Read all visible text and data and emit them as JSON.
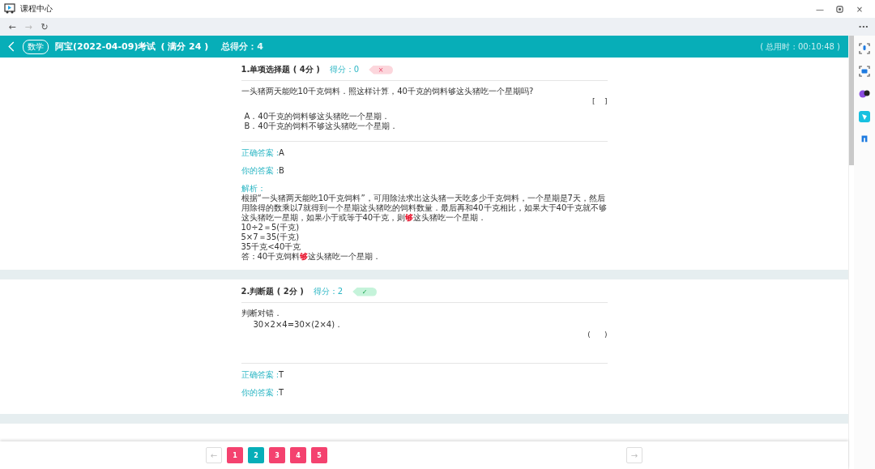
{
  "window": {
    "title": "课程中心"
  },
  "header": {
    "subject": "数学",
    "title": "阿宝(2022-04-09)考试",
    "full_score": "( 满分 24 )",
    "total": "总得分：4",
    "time": "( 总用时 : 00:10:48 )"
  },
  "questions": [
    {
      "heading": "1.单项选择题 ( 4分 )",
      "score": "得分：0",
      "passed": false,
      "mark": "×",
      "stem": [
        "一头猪两天能吃10千克饲料．照这样计算，40千克的饲料够这头猪吃一个星期吗?"
      ],
      "blank": "[    ]",
      "options": [
        "A．40千克的饲料够这头猪吃一个星期．",
        "B．40千克的饲料不够这头猪吃一个星期．"
      ],
      "correct_label": "正确答案 :",
      "correct": "A",
      "yours_label": "你的答案 :",
      "yours": "B",
      "analysis_label": "解析：",
      "analysis": [
        [
          {
            "text": "根据“一头猪两天能吃10千克饲料”，可用除法求出这头猪一天吃多少千克饲料，一个星期是7天，然后用除得的数乘以7就得到一个星期这头猪吃的饲料数量．最后再和40千克相比，如果大于40千克就不够这头猪吃一星期，如果小于或等于40千克，则",
            "highlight": false
          },
          {
            "text": "够",
            "highlight": true
          },
          {
            "text": "这头猪吃一个星期．",
            "highlight": false
          }
        ],
        [
          {
            "text": "10÷2＝5(千克)",
            "highlight": false
          }
        ],
        [
          {
            "text": "5×7＝35(千克)",
            "highlight": false
          }
        ],
        [
          {
            "text": "35千克<40千克",
            "highlight": false
          }
        ],
        [
          {
            "text": "答：40千克饲料",
            "highlight": false
          },
          {
            "text": "够",
            "highlight": true
          },
          {
            "text": "这头猪吃一个星期．",
            "highlight": false
          }
        ]
      ]
    },
    {
      "heading": "2.判断题 ( 2分 )",
      "score": "得分：2",
      "passed": true,
      "mark": "✓",
      "stem": [
        "判断对错．",
        "30×2×4=30×(2×4)．"
      ],
      "blank": "(      )",
      "correct_label": "正确答案 :",
      "correct": "T",
      "yours_label": "你的答案 :",
      "yours": "T"
    }
  ],
  "pager": {
    "prev": "←",
    "next": "→",
    "pages": [
      {
        "label": "1",
        "correct": false
      },
      {
        "label": "2",
        "correct": true
      },
      {
        "label": "3",
        "correct": false
      },
      {
        "label": "4",
        "correct": false
      },
      {
        "label": "5",
        "correct": false
      }
    ]
  },
  "nav": {
    "back": "←",
    "forward": "→",
    "reload": "↻",
    "more": "···"
  },
  "window_controls": {
    "minimize": "—",
    "close": "×"
  }
}
